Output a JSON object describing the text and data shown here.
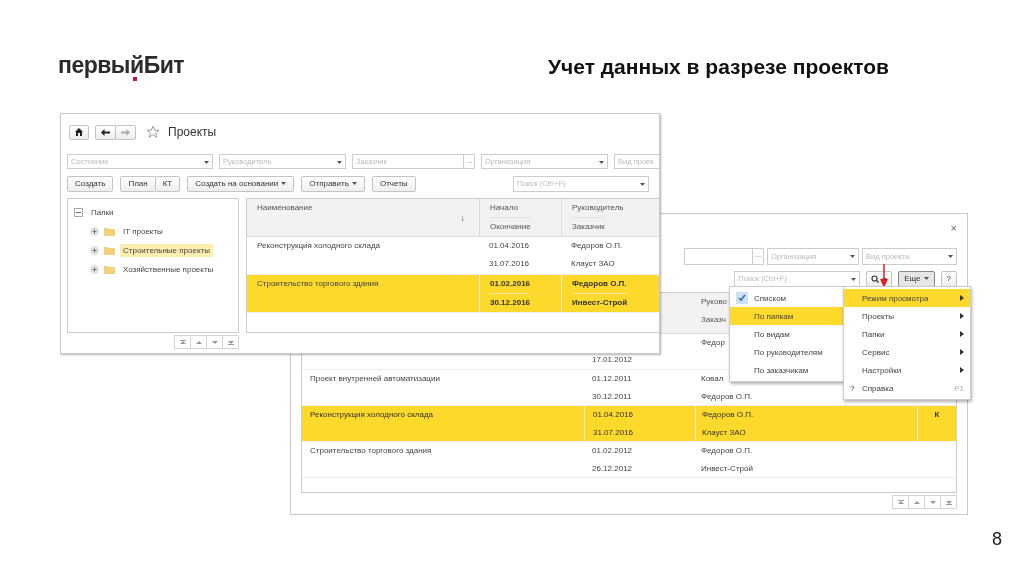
{
  "slide": {
    "logo": "первыйБит",
    "title": "Учет данных в разрезе проектов",
    "page_number": "8"
  },
  "front_window": {
    "title": "Проекты",
    "filters": [
      {
        "placeholder": "Состояние",
        "kind": "dropdown"
      },
      {
        "placeholder": "Руководитель",
        "kind": "dropdown"
      },
      {
        "placeholder": "Заказчик",
        "kind": "choice",
        "button": "..."
      },
      {
        "placeholder": "Организация",
        "kind": "dropdown"
      },
      {
        "placeholder": "Вид проек",
        "kind": "plain"
      }
    ],
    "toolbar": [
      {
        "buttons": [
          {
            "label": "Создать",
            "kind": "button"
          }
        ]
      },
      {
        "buttons": [
          {
            "label": "План",
            "kind": "button"
          },
          {
            "label": "КТ",
            "kind": "button"
          }
        ]
      },
      {
        "buttons": [
          {
            "label": "Создать на основании",
            "kind": "menu"
          }
        ]
      },
      {
        "buttons": [
          {
            "label": "Отправить",
            "kind": "menu"
          }
        ]
      },
      {
        "buttons": [
          {
            "label": "Отчеты",
            "kind": "button"
          }
        ]
      }
    ],
    "search": {
      "placeholder": "Поиск (Ctrl+F)"
    },
    "tree": {
      "label": "Папки",
      "expanded": true,
      "selected": false,
      "children": [
        {
          "label": "IT проекты",
          "expanded": false,
          "selected": false
        },
        {
          "label": "Строительные проекты",
          "expanded": false,
          "selected": true
        },
        {
          "label": "Хозяйственные проекты",
          "expanded": false,
          "selected": false
        }
      ]
    },
    "table": {
      "columns": [
        {
          "top": "Наименование",
          "sort": "↓"
        },
        {
          "top": "Начало",
          "bottom": "Окончание"
        },
        {
          "top": "Руководитель",
          "bottom": "Заказчик"
        }
      ],
      "rows": [
        {
          "name": "Реконструкция холодного склада",
          "start": "01.04.2016",
          "end": "31.07.2016",
          "manager": "Федоров О.П.",
          "customer": "Клауст ЗАО",
          "selected": false
        },
        {
          "name": "Строительство торгового здания",
          "start": "01.02.2016",
          "end": "30.12.2016",
          "manager": "Федоров О.П.",
          "customer": "Инвест-Строй",
          "selected": true
        }
      ]
    }
  },
  "back_window": {
    "close": "×",
    "filters": [
      {
        "kind": "choice",
        "button": "..."
      },
      {
        "placeholder": "Организация",
        "kind": "dropdown"
      },
      {
        "placeholder": "Вид проекта",
        "kind": "dropdown"
      }
    ],
    "search": {
      "placeholder": "Поиск (Ctrl+F)"
    },
    "more_button": "Еще",
    "help_button": "?",
    "table": {
      "columns": [
        {
          "top": "Руково",
          "bottom": "Заказч"
        }
      ],
      "rows": [
        {
          "manager": "Федор",
          "end": "17.01.2012",
          "selected": false
        },
        {
          "name": "Проект внутренней автоматизации",
          "start": "01.12.2011",
          "manager": "Ковал",
          "end": "30.12.2011",
          "customer": "Федоров О.П.",
          "selected": false
        },
        {
          "name": "Реконструкция холодного склада",
          "start": "01.04.2016",
          "manager": "Федоров О.П.",
          "flag": "К",
          "end": "31.07.2016",
          "customer": "Клауст ЗАО",
          "selected": true
        },
        {
          "name": "Строительство торгового здания",
          "start": "01.02.2012",
          "manager": "Федоров О.П.",
          "end": "26.12.2012",
          "customer": "Инвест-Строй",
          "selected": false
        }
      ]
    }
  },
  "menu": {
    "items": [
      {
        "label": "Режим просмотра",
        "kind": "submenu",
        "selected": true
      },
      {
        "label": "Проекты",
        "kind": "submenu",
        "selected": false
      },
      {
        "label": "Папки",
        "kind": "submenu",
        "selected": false
      },
      {
        "label": "Сервис",
        "kind": "submenu",
        "selected": false
      },
      {
        "label": "Настройки",
        "kind": "submenu",
        "selected": false
      },
      {
        "label": "Справка",
        "kind": "command",
        "icon": "?",
        "shortcut": "F1",
        "selected": false
      }
    ]
  },
  "submenu": {
    "items": [
      {
        "label": "Списком",
        "checked": true,
        "selected": false
      },
      {
        "label": "По папкам",
        "checked": false,
        "selected": true
      },
      {
        "label": "По видам",
        "checked": false,
        "selected": false
      },
      {
        "label": "По руководителям",
        "checked": false,
        "selected": false
      },
      {
        "label": "По заказчикам",
        "checked": false,
        "selected": false
      }
    ]
  }
}
